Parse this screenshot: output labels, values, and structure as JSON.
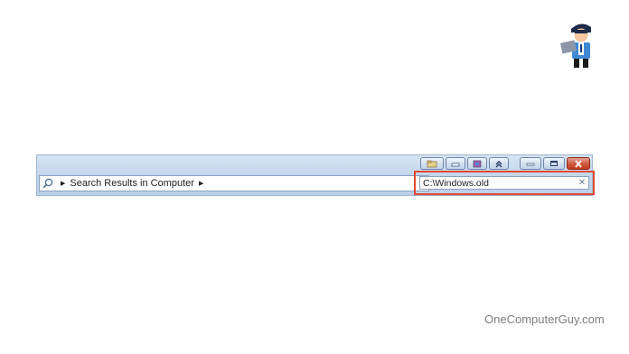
{
  "address_bar": {
    "location_icon": "search-icon",
    "breadcrumb_label": "Search Results in Computer",
    "dropdown_icon": "chevron-down-icon"
  },
  "refresh_icon": "refresh-icon",
  "search_box": {
    "value": "C:\\Windows.old",
    "clear_icon": "close-icon",
    "highlight_color": "#e04a2f"
  },
  "caption_buttons": [
    "folder-icon",
    "window-icon",
    "window-icon",
    "up-icon"
  ],
  "window_controls": [
    "minimize-icon",
    "maximize-icon",
    "close-icon"
  ],
  "watermark": "OneComputerGuy.com",
  "logo_icon": "person-with-laptop-logo"
}
